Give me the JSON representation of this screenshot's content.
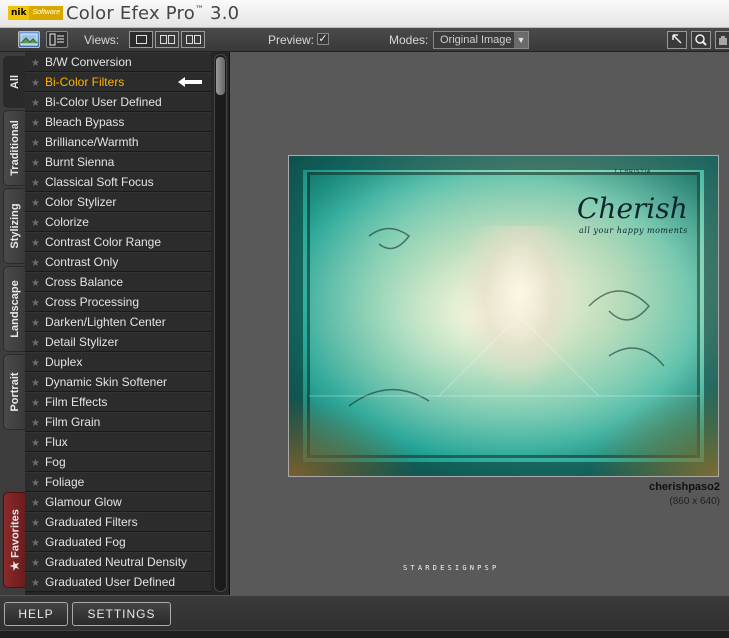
{
  "app": {
    "logo_brand": "nik",
    "logo_sub": "Software",
    "title": "Color Efex Pro",
    "trademark": "™",
    "version": "3.0"
  },
  "toolbar": {
    "views_label": "Views:",
    "preview_label": "Preview:",
    "preview_checked": "✓",
    "modes_label": "Modes:",
    "mode_value": "Original Image",
    "mode_arrow": "▼",
    "tool_icons": [
      "pointer-icon",
      "zoom-icon",
      "hand-icon"
    ]
  },
  "side_tabs": [
    "All",
    "Traditional",
    "Stylizing",
    "Landscape",
    "Portrait",
    "Favorites"
  ],
  "favorites_star": "★",
  "filters": {
    "star": "★",
    "selected_index": 1,
    "items": [
      "B/W Conversion",
      "Bi-Color Filters",
      "Bi-Color User Defined",
      "Bleach Bypass",
      "Brilliance/Warmth",
      "Burnt Sienna",
      "Classical Soft Focus",
      "Color Stylizer",
      "Colorize",
      "Contrast Color Range",
      "Contrast Only",
      "Cross Balance",
      "Cross Processing",
      "Darken/Lighten Center",
      "Detail Stylizer",
      "Duplex",
      "Dynamic Skin Softener",
      "Film Effects",
      "Film Grain",
      "Flux",
      "Fog",
      "Foliage",
      "Glamour Glow",
      "Graduated Filters",
      "Graduated Fog",
      "Graduated Neutral Density",
      "Graduated User Defined"
    ]
  },
  "image": {
    "name": "cherishpaso2",
    "dimensions": "(860 x 640)",
    "title_text": "Cherish",
    "subtitle_text": "all your happy moments",
    "stamp_text": "T.CHRISTIA"
  },
  "watermark": "STARDESIGNPSP",
  "bottom": {
    "help_label": "HELP",
    "settings_label": "SETTINGS"
  },
  "colors": {
    "selected_filter": "#ffb300",
    "favorites_tab": "#8c2a2a"
  }
}
